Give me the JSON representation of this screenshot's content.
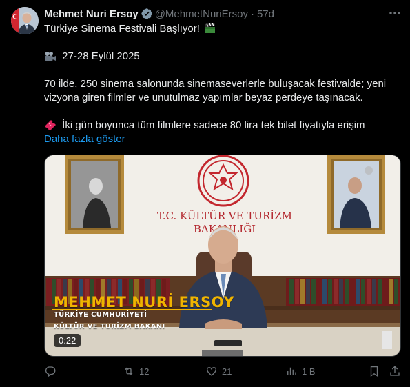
{
  "author": {
    "name": "Mehmet Nuri Ersoy",
    "handle": "@MehmetNuriErsoy",
    "separator": "·",
    "time": "57d",
    "verified": true
  },
  "tweet": {
    "line1": "Türkiye Sinema Festivali Başlıyor!",
    "line1_emoji": "clapper-board",
    "date_line": "27-28 Eylül 2025",
    "date_emoji": "movie-camera",
    "body_line1": "70 ilde, 250 sinema salonunda sinemaseverlerle buluşacak festivalde; yeni",
    "body_line2": "vizyona giren filmler ve unutulmaz yapımlar beyaz perdeye taşınacak.",
    "ticket_line": "İki gün boyunca tüm filmlere sadece 80 lira tek bilet fiyatıyla erişim",
    "ticket_emoji": "ticket",
    "show_more": "Daha fazla göster"
  },
  "video": {
    "wall_sign_line1": "T.C. KÜLTÜR VE TURİZM",
    "wall_sign_line2": "BAKANLIĞI",
    "lower_third_name": "MEHMET NURİ ERSOY",
    "lower_third_sub1": "TÜRKİYE CUMHURİYETİ",
    "lower_third_sub2": "KÜLTÜR VE TURİZM BAKANI",
    "duration": "0:22"
  },
  "actions": {
    "reply_count": "",
    "retweet_count": "12",
    "like_count": "21",
    "views_count": "1 B"
  },
  "colors": {
    "background": "#000000",
    "text_primary": "#e7e9ea",
    "text_secondary": "#71767b",
    "link": "#1d9bf0",
    "verified": "#829aab",
    "lower_third_accent": "#f0b400"
  },
  "icons": [
    "more-icon",
    "verified-badge-icon",
    "reply-icon",
    "retweet-icon",
    "like-icon",
    "views-icon",
    "bookmark-icon",
    "share-icon"
  ]
}
